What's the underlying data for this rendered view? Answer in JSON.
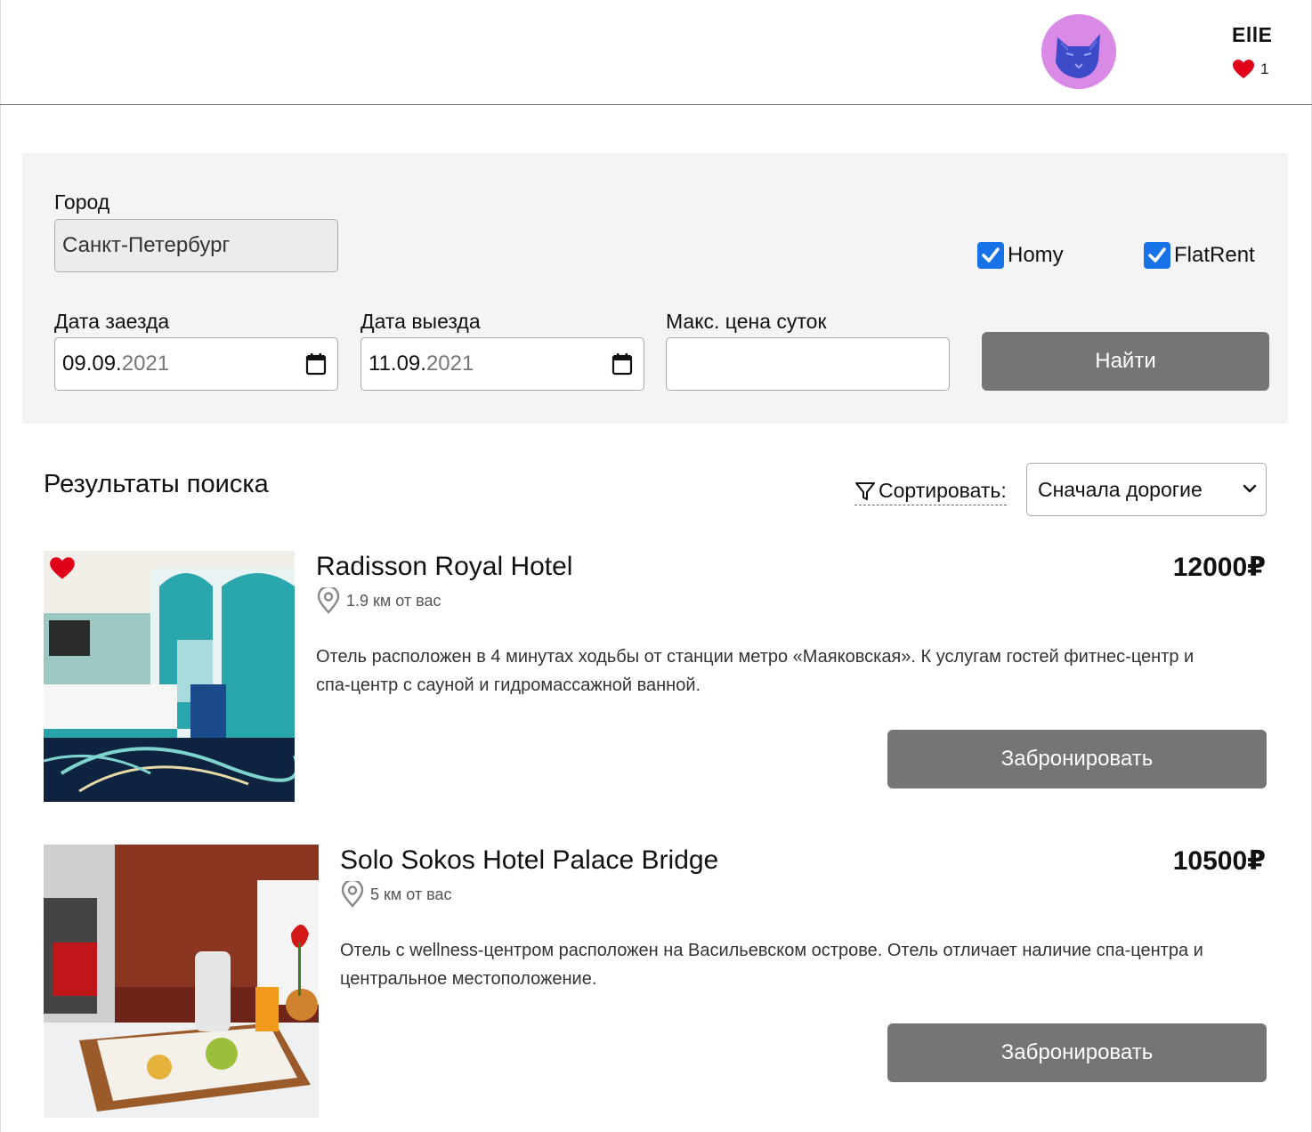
{
  "header": {
    "username": "EllE",
    "favorites_count": "1",
    "colors": {
      "heart": "#e0001a",
      "avatar_bg": "#d98ae6"
    }
  },
  "search": {
    "city_label": "Город",
    "city_value": "Санкт-Петербург",
    "checkin_label": "Дата заезда",
    "checkin_day_month": "09.09.",
    "checkin_year": "2021",
    "checkout_label": "Дата выезда",
    "checkout_day_month": "11.09.",
    "checkout_year": "2021",
    "max_price_label": "Макс. цена суток",
    "max_price_value": "",
    "providers": [
      {
        "label": "Homy",
        "checked": true
      },
      {
        "label": "FlatRent",
        "checked": true
      }
    ],
    "search_button": "Найти"
  },
  "results": {
    "title": "Результаты поиска",
    "sort_label": "Сортировать:",
    "sort_value": "Сначала дорогие",
    "items": [
      {
        "name": "Radisson Royal Hotel",
        "distance": "1.9 км от вас",
        "price": "12000₽",
        "favorite": true,
        "description_line1": "Отель расположен в 4 минутах ходьбы от станции метро «Маяковская». К услугам гостей фитнес-центр и",
        "description_line2": "спа-центр с сауной и гидромассажной ванной.",
        "book_button": "Забронировать"
      },
      {
        "name": "Solo Sokos Hotel Palace Bridge",
        "distance": "5 км от вас",
        "price": "10500₽",
        "favorite": false,
        "description_line1": "Отель с wellness-центром расположен на Васильевском острове. Отель отличает наличие спа-центра и",
        "description_line2": "центральное местоположение.",
        "book_button": "Забронировать"
      }
    ]
  },
  "colors": {
    "button_bg": "#757575",
    "checkbox": "#1672e6",
    "panel_bg": "#f4f4f4"
  }
}
